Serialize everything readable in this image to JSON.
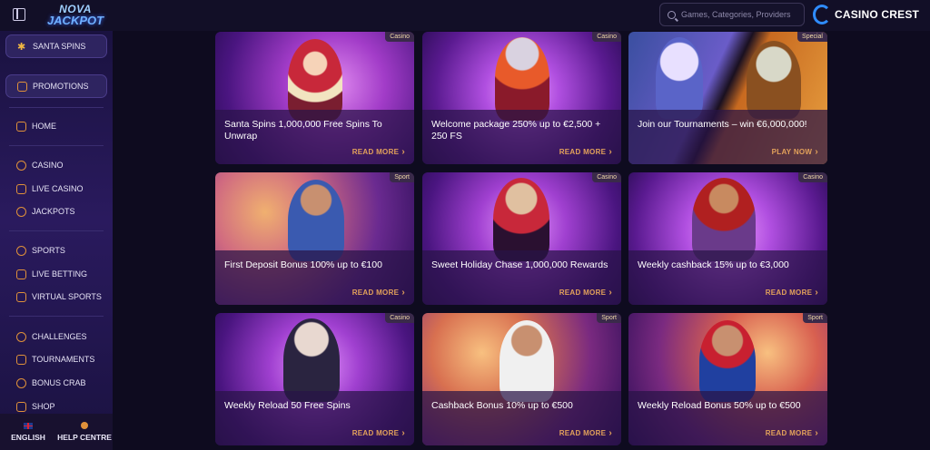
{
  "header": {
    "logo_line1": "NOVA",
    "logo_line2": "JACKPOT",
    "search_placeholder": "Games, Categories, Providers",
    "brand": "CASINO CREST"
  },
  "sidebar": {
    "featured": "SANTA SPINS",
    "promotions": "PROMOTIONS",
    "items": [
      {
        "label": "HOME",
        "icon": "home-icon"
      },
      {
        "label": "CASINO",
        "icon": "casino-chip-icon"
      },
      {
        "label": "LIVE CASINO",
        "icon": "live-casino-icon"
      },
      {
        "label": "JACKPOTS",
        "icon": "jackpot-icon"
      },
      {
        "label": "SPORTS",
        "icon": "sports-ball-icon"
      },
      {
        "label": "LIVE BETTING",
        "icon": "live-betting-icon"
      },
      {
        "label": "VIRTUAL SPORTS",
        "icon": "virtual-sports-icon"
      },
      {
        "label": "CHALLENGES",
        "icon": "challenges-icon"
      },
      {
        "label": "TOURNAMENTS",
        "icon": "tournaments-icon"
      },
      {
        "label": "BONUS CRAB",
        "icon": "bonus-crab-icon"
      },
      {
        "label": "SHOP",
        "icon": "shop-icon"
      }
    ],
    "language": "ENGLISH",
    "help": "HELP CENTRE"
  },
  "promos": [
    {
      "tag": "Casino",
      "title": "Santa Spins 1,000,000 Free Spins To Unwrap",
      "cta": "READ MORE"
    },
    {
      "tag": "Casino",
      "title": "Welcome package 250% up to €2,500 + 250 FS",
      "cta": "READ MORE"
    },
    {
      "tag": "Special",
      "title": "Join our Tournaments – win €6,000,000!",
      "cta": "PLAY NOW"
    },
    {
      "tag": "Sport",
      "title": "First Deposit Bonus 100% up to €100",
      "cta": "READ MORE"
    },
    {
      "tag": "Casino",
      "title": "Sweet Holiday Chase 1,000,000 Rewards",
      "cta": "READ MORE"
    },
    {
      "tag": "Casino",
      "title": "Weekly cashback 15% up to €3,000",
      "cta": "READ MORE"
    },
    {
      "tag": "Casino",
      "title": "Weekly Reload 50 Free Spins",
      "cta": "READ MORE"
    },
    {
      "tag": "Sport",
      "title": "Cashback Bonus 10% up to €500",
      "cta": "READ MORE"
    },
    {
      "tag": "Sport",
      "title": "Weekly Reload Bonus 50% up to €500",
      "cta": "READ MORE"
    }
  ],
  "colors": {
    "accent_orange": "#e3a25b",
    "sidebar_purple": "#2a1a5e",
    "brand_blue": "#2f8cff"
  }
}
